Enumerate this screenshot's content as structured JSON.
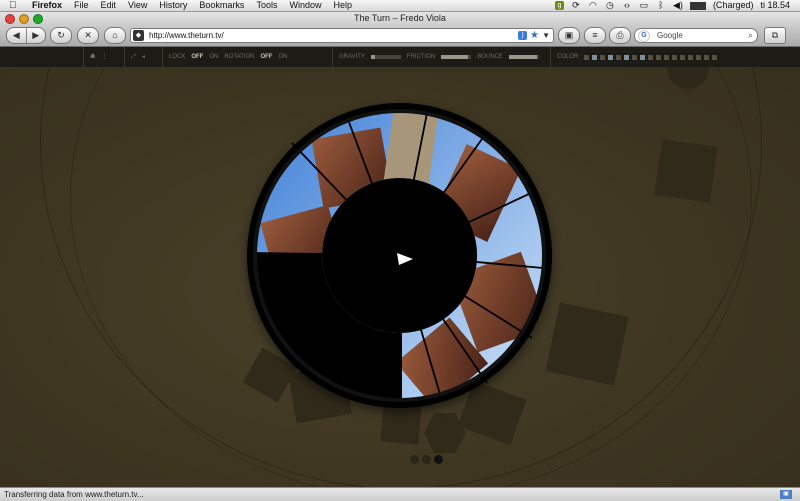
{
  "menubar": {
    "app": "Firefox",
    "menus": [
      "File",
      "Edit",
      "View",
      "History",
      "Bookmarks",
      "Tools",
      "Window",
      "Help"
    ],
    "battery": "(Charged)",
    "clock": "ti 18.54"
  },
  "window": {
    "title": "The Turn – Fredo Viola"
  },
  "toolbar": {
    "url": "http://www.theturn.tv/",
    "search_placeholder": "Google"
  },
  "controls": {
    "lock_label": "LOCK",
    "lock_off": "OFF",
    "lock_on": "ON",
    "rotation_label": "ROTATION",
    "rotation_off": "OFF",
    "rotation_on": "ON",
    "gravity_label": "GRAVITY",
    "gravity_level": 0.15,
    "friction_label": "FRICTION",
    "friction_level": 0.9,
    "bounce_label": "BOUNCE",
    "bounce_level": 0.95,
    "color_label": "COLOR"
  },
  "statusbar": {
    "text": "Transferring data from www.theturn.tv..."
  }
}
